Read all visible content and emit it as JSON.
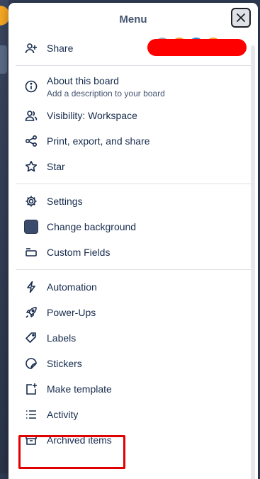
{
  "menu": {
    "title": "Menu",
    "share": "Share",
    "about_title": "About this board",
    "about_sub": "Add a description to your board",
    "visibility": "Visibility: Workspace",
    "print": "Print, export, and share",
    "star": "Star",
    "settings": "Settings",
    "change_background": "Change background",
    "custom_fields": "Custom Fields",
    "automation": "Automation",
    "powerups": "Power-Ups",
    "labels": "Labels",
    "stickers": "Stickers",
    "make_template": "Make template",
    "activity": "Activity",
    "archived": "Archived items"
  },
  "colors": {
    "background_swatch": "#3b4b6b",
    "redaction": "#ff0000",
    "highlight": "#e00000"
  }
}
